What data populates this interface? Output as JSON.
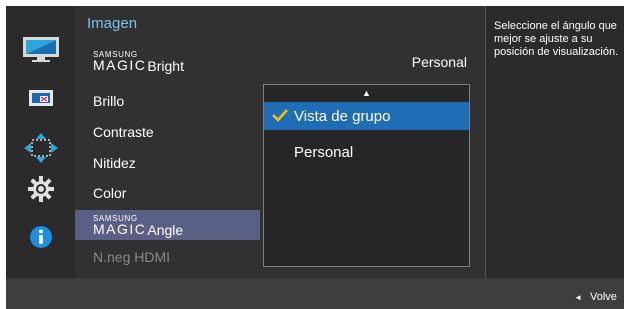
{
  "left_rail": {
    "icons": [
      "monitor-picture-icon",
      "color-screen-icon",
      "position-arrows-icon",
      "settings-gear-icon",
      "info-icon"
    ]
  },
  "menu": {
    "title": "Imagen",
    "items": [
      {
        "label": "Bright",
        "magic_prefix_top": "SAMSUNG",
        "magic_prefix_bottom": "MAGIC"
      },
      {
        "label": "Brillo"
      },
      {
        "label": "Contraste"
      },
      {
        "label": "Nitidez"
      },
      {
        "label": "Color"
      },
      {
        "label": "Angle",
        "magic_prefix_top": "SAMSUNG",
        "magic_prefix_bottom": "MAGIC",
        "selected": true
      },
      {
        "label": "N.neg HDMI",
        "disabled": true
      }
    ]
  },
  "value": {
    "current": "Personal"
  },
  "dropdown": {
    "scroll_up": "▲",
    "options": [
      {
        "label": "Vista de grupo",
        "selected": true
      },
      {
        "label": "Personal",
        "selected": false
      }
    ]
  },
  "help": {
    "text": "Seleccione el ángulo que mejor se ajuste a su posición de visualización."
  },
  "footer": {
    "back_arrow": "◄",
    "back_label": "Volve"
  },
  "colors": {
    "accent_selection": "#1e6db5",
    "menu_highlight": "#5a5f86",
    "title": "#7ec2e8"
  }
}
